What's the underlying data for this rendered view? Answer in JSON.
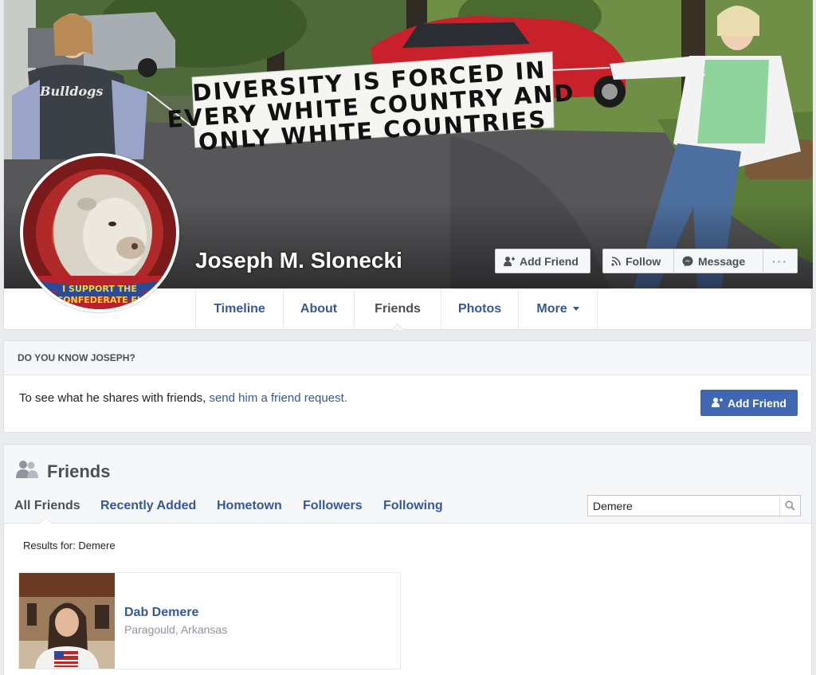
{
  "profile": {
    "name": "Joseph M. Slonecki",
    "cover_sign": [
      "DIVERSITY IS FORCED IN",
      "EVERY WHITE COUNTRY AND",
      "ONLY WHITE COUNTRIES"
    ],
    "profile_pic_banner": [
      "I SUPPORT THE",
      "CONFEDERATE FL"
    ]
  },
  "cover_actions": {
    "add_friend": "Add Friend",
    "follow": "Follow",
    "message": "Message",
    "more": "···"
  },
  "tabs": [
    {
      "label": "Timeline"
    },
    {
      "label": "About"
    },
    {
      "label": "Friends"
    },
    {
      "label": "Photos"
    },
    {
      "label": "More"
    }
  ],
  "know": {
    "heading": "DO YOU KNOW JOSEPH?",
    "text": "To see what he shares with friends, ",
    "link": "send him a friend request.",
    "button": "Add Friend"
  },
  "friends": {
    "title": "Friends",
    "tabs": [
      {
        "label": "All Friends"
      },
      {
        "label": "Recently Added"
      },
      {
        "label": "Hometown"
      },
      {
        "label": "Followers"
      },
      {
        "label": "Following"
      }
    ],
    "search_value": "Demere",
    "results_label": "Results for: Demere",
    "results": [
      {
        "name": "Dab Demere",
        "location": "Paragould, Arkansas"
      }
    ]
  },
  "colors": {
    "link": "#365899",
    "primary_button": "#4267b2",
    "background": "#e9ebee"
  }
}
